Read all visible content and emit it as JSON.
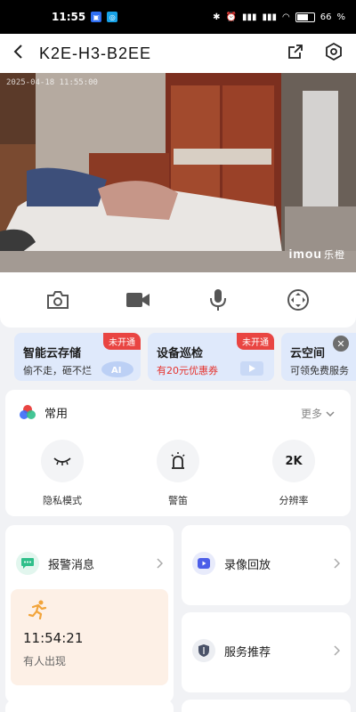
{
  "status": {
    "time": "11:55",
    "battery": "66",
    "battery_level": 0.66
  },
  "header": {
    "title": "K2E-H3-B2EE"
  },
  "video": {
    "timestamp": "2025-04-18 11:55:00",
    "watermark": "imou",
    "watermark_cn": "乐橙"
  },
  "promos": [
    {
      "title": "智能云存储",
      "subtitle": "偷不走，砸不烂",
      "badge": "未开通"
    },
    {
      "title": "设备巡检",
      "subtitle": "有20元优惠券",
      "badge": "未开通"
    },
    {
      "title": "云空间",
      "subtitle": "可领免费服务"
    }
  ],
  "common": {
    "title": "常用",
    "more": "更多",
    "features": [
      {
        "label": "隐私模式"
      },
      {
        "label": "警笛"
      },
      {
        "label": "分辨率",
        "icon_text": "2K"
      }
    ]
  },
  "alarm": {
    "title": "报警消息",
    "event_time": "11:54:21",
    "event_desc": "有人出现"
  },
  "playback": {
    "title": "录像回放"
  },
  "service": {
    "title": "服务推荐"
  },
  "colors": {
    "accent": "#3b6cf6",
    "badge": "#e94542",
    "alarm_icon": "#2fbf8a",
    "event_bg": "#fdf0e6"
  }
}
